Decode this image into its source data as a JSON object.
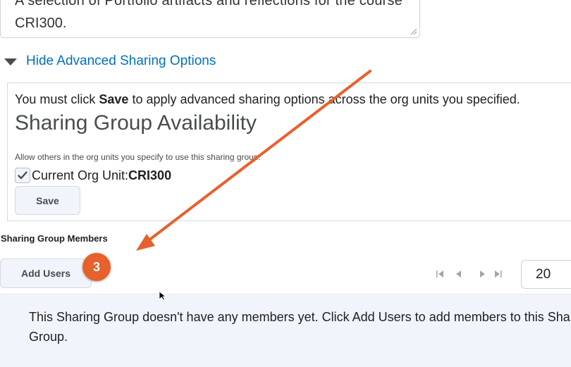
{
  "description_field": {
    "line1": "A selection of Portfolio artifacts and reflections for the course",
    "line2": "CRI300."
  },
  "advanced_toggle": {
    "label": "Hide Advanced Sharing Options",
    "icon": "triangle-down-icon"
  },
  "advanced_panel": {
    "note_prefix": "You must click ",
    "note_bold": "Save",
    "note_suffix": " to apply advanced sharing options across the org units you specified.",
    "heading": "Sharing Group Availability",
    "description": "Allow others in the org units you specify to use this sharing group.",
    "current_org_label": "Current Org Unit: ",
    "current_org_value": "CRI300",
    "current_org_checked": true,
    "save_label": "Save"
  },
  "members": {
    "label": "Sharing Group Members",
    "add_users_label": "Add Users",
    "step_badge": "3",
    "page_size": "20",
    "empty_message": "This Sharing Group doesn't have any members yet. Click Add Users to add members to this Sharing Group."
  },
  "colors": {
    "link": "#006fbf",
    "badge": "#e8602c",
    "arrow": "#e8602c",
    "panel_bg": "#f1f5fb"
  }
}
